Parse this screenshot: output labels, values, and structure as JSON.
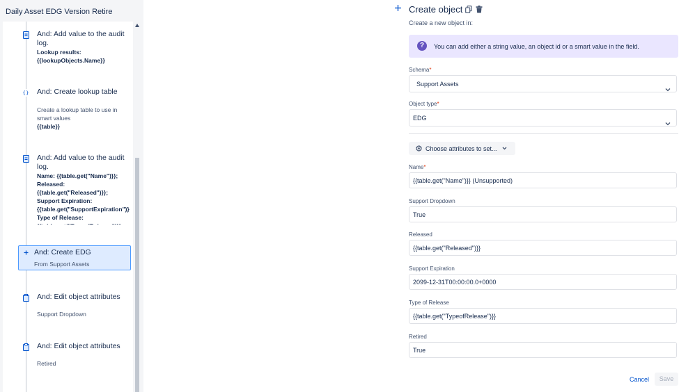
{
  "sidebar": {
    "title": "Daily Asset EDG Version Retire",
    "rules": [
      {
        "icon": "audit-log-icon",
        "title": "And: Add value to the audit log.",
        "description": "Lookup results: {{lookupObjects.Name}}"
      },
      {
        "icon": "lookup-table-icon",
        "title": "And: Create lookup table",
        "description": "Create a lookup table to use in smart values",
        "description2": "{{table}}"
      },
      {
        "icon": "audit-log-icon",
        "title": "And: Add value to the audit log.",
        "description": "Name: {{table.get(\"Name\")}}; Released: {{table.get(\"Released\")}}; Support Expiration: {{table.get(\"SupportExpiration\")}}; Type of Release: {{table.get(\"TypeofRelease\")}}"
      },
      {
        "icon": "plus-icon",
        "title": "And: Create EDG",
        "description": "From Support Assets"
      },
      {
        "icon": "edit-object-icon",
        "title": "And: Edit object attributes",
        "description": "Support Dropdown"
      },
      {
        "icon": "edit-object-icon",
        "title": "And: Edit object attributes",
        "description": "Retired"
      }
    ]
  },
  "panel": {
    "title": "Create object",
    "subtitle": "Create a new object in:",
    "info_text": "You can add either a string value, an object id or a smart value in the field.",
    "schema_label": "Schema",
    "schema_value": "Support Assets",
    "object_type_label": "Object type",
    "object_type_value": "EDG",
    "required_mark": "*",
    "choose_attributes_label": "Choose attributes to set...",
    "fields": [
      {
        "label": "Name",
        "required": "*",
        "value": "{{table.get(\"Name\")}} (Unsupported)"
      },
      {
        "label": "Support Dropdown",
        "required": "",
        "value": "True"
      },
      {
        "label": "Released",
        "required": "",
        "value": "{{table.get(\"Released\")}}"
      },
      {
        "label": "Support Expiration",
        "required": "",
        "value": "2099-12-31T00:00:00.0+0000"
      },
      {
        "label": "Type of Release",
        "required": "",
        "value": "{{table.get(\"TypeofRelease\")}}"
      },
      {
        "label": "Retired",
        "required": "",
        "value": "True"
      }
    ],
    "cancel_label": "Cancel",
    "save_label": "Save"
  },
  "colors": {
    "accent": "#0052cc",
    "info_bg": "#eae6ff",
    "info_icon": "#6554c0",
    "selected_bg": "#deebff",
    "selected_border": "#4c9aff"
  }
}
